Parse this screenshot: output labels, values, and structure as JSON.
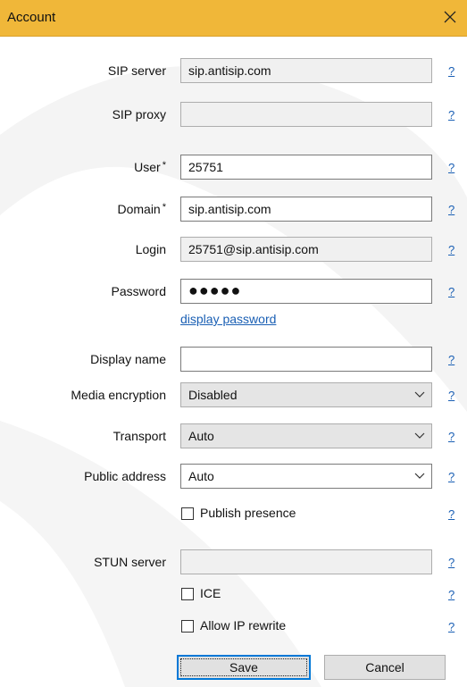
{
  "window": {
    "title": "Account"
  },
  "colors": {
    "titlebar": "#f0b739",
    "link": "#1a5fb4",
    "default_button_border": "#0078d7"
  },
  "fields": {
    "sip_server": {
      "label": "SIP server",
      "value": "sip.antisip.com"
    },
    "sip_proxy": {
      "label": "SIP proxy",
      "value": ""
    },
    "user": {
      "label": "User",
      "required_mark": "*",
      "value": "25751"
    },
    "domain": {
      "label": "Domain",
      "required_mark": "*",
      "value": "sip.antisip.com"
    },
    "login": {
      "label": "Login",
      "value": "25751@sip.antisip.com"
    },
    "password": {
      "label": "Password",
      "value": "●●●●●"
    },
    "display_name": {
      "label": "Display name",
      "value": ""
    },
    "media_encryption": {
      "label": "Media encryption",
      "value": "Disabled"
    },
    "transport": {
      "label": "Transport",
      "value": "Auto"
    },
    "public_address": {
      "label": "Public address",
      "value": "Auto"
    },
    "stun_server": {
      "label": "STUN server",
      "value": ""
    }
  },
  "links": {
    "display_password": "display password",
    "help": "?"
  },
  "checkboxes": {
    "publish_presence": {
      "label": "Publish presence",
      "checked": false
    },
    "ice": {
      "label": "ICE",
      "checked": false
    },
    "allow_ip_rewrite": {
      "label": "Allow IP rewrite",
      "checked": false
    }
  },
  "buttons": {
    "save": "Save",
    "cancel": "Cancel"
  }
}
